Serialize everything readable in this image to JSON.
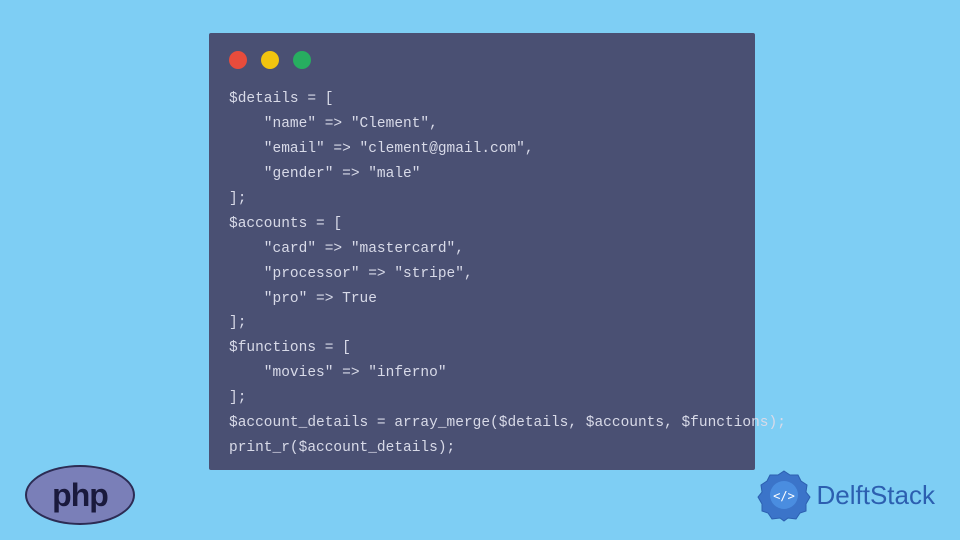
{
  "code": {
    "lines": [
      "$details = [",
      "    \"name\" => \"Clement\",",
      "    \"email\" => \"clement@gmail.com\",",
      "    \"gender\" => \"male\"",
      "];",
      "$accounts = [",
      "    \"card\" => \"mastercard\",",
      "    \"processor\" => \"stripe\",",
      "    \"pro\" => True",
      "];",
      "$functions = [",
      "    \"movies\" => \"inferno\"",
      "];",
      "$account_details = array_merge($details, $accounts, $functions);",
      "print_r($account_details);"
    ]
  },
  "logos": {
    "php_text": "php",
    "delft_text": "DelftStack"
  }
}
